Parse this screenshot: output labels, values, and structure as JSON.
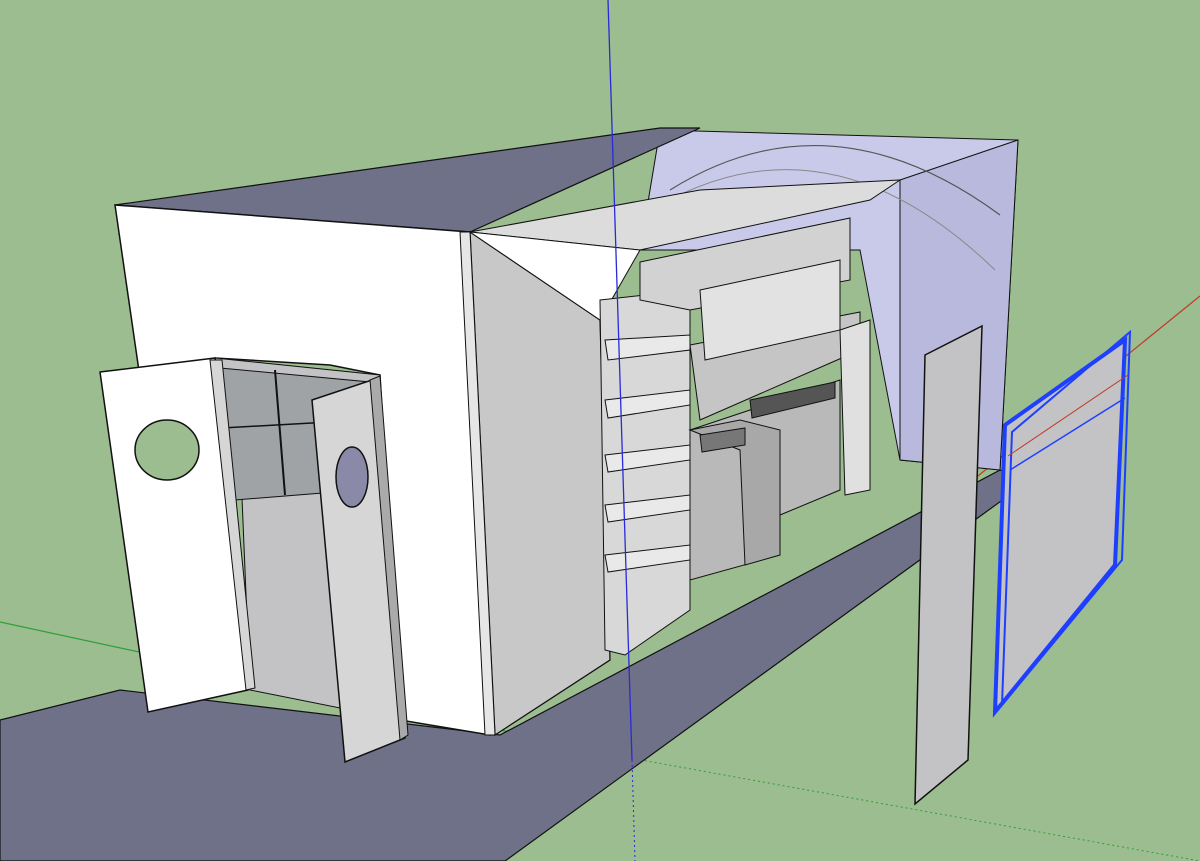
{
  "app": {
    "view": "3d-modeling-viewport",
    "colors": {
      "sky_ground": "#9bbd8f",
      "floor": "#6e7188",
      "wall_white": "#ffffff",
      "wall_shadow": "#cfcfd4",
      "wall_grey": "#c3c3c6",
      "interior_blue": "#c9c9ea",
      "axis_red": "#c0392b",
      "axis_green": "#2f9e3a",
      "axis_blue": "#2a2ad8",
      "selection_blue": "#1f3fff",
      "edge": "#111111"
    }
  },
  "model": {
    "selected_object": "loose-wall-panel",
    "objects": [
      "floor-slab",
      "container-box",
      "left-door",
      "right-door",
      "shelving-unit",
      "kitchen-counter",
      "standing-panel",
      "selected-panel"
    ]
  }
}
